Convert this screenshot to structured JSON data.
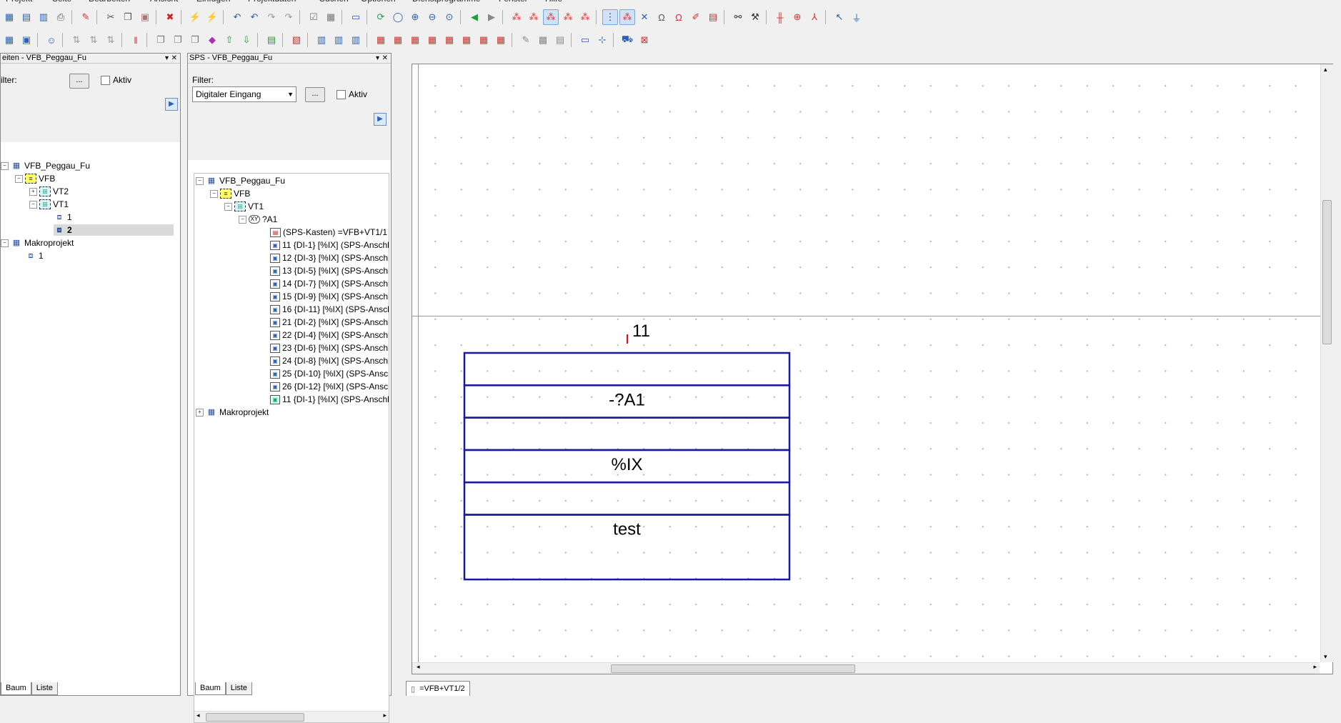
{
  "menu": {
    "items": [
      "Projekt",
      "Seite",
      "Bearbeiten",
      "Ansicht",
      "Einfügen",
      "Projektdaten",
      "Suchen",
      "Optionen",
      "Dienstprogramme",
      "Fenster",
      "Hilfe"
    ]
  },
  "left_panel": {
    "title": "eiten - VFB_Peggau_Fu",
    "filter_label": "ilter:",
    "filter_btn": "...",
    "aktiv_label": "Aktiv",
    "tree": [
      {
        "label": "VFB_Peggau_Fu",
        "icon": "project-icon"
      },
      {
        "label": "VFB",
        "icon": "structure-icon"
      },
      {
        "label": "VT2",
        "icon": "installation-icon"
      },
      {
        "label": "VT1",
        "icon": "installation-icon"
      },
      {
        "label": "1",
        "icon": "page-icon"
      },
      {
        "label": "2",
        "icon": "page-icon"
      },
      {
        "label": "Makroprojekt",
        "icon": "project-icon"
      },
      {
        "label": "1",
        "icon": "page-icon"
      }
    ],
    "tabs": [
      "Baum",
      "Liste"
    ]
  },
  "middle_panel": {
    "title": "SPS - VFB_Peggau_Fu",
    "filter_label": "Filter:",
    "filter_value": "Digitaler Eingang",
    "filter_btn": "...",
    "aktiv_label": "Aktiv",
    "tree_top": [
      {
        "label": "VFB_Peggau_Fu",
        "icon": "project-icon"
      },
      {
        "label": "VFB",
        "icon": "structure-icon"
      },
      {
        "label": "VT1",
        "icon": "installation-icon"
      },
      {
        "label": "?A1",
        "icon": "device-icon"
      },
      {
        "label": "(SPS-Kasten) =VFB+VT1/1",
        "icon": "plc-box-icon"
      }
    ],
    "connections": [
      "11 {DI-1} [%IX] (SPS-Anschl",
      "12 {DI-3} [%IX] (SPS-Anschl",
      "13 {DI-5} [%IX] (SPS-Anschl",
      "14 {DI-7} [%IX] (SPS-Anschl",
      "15 {DI-9} [%IX] (SPS-Anschl",
      "16 {DI-11} [%IX] (SPS-Ansch",
      "21 {DI-2} [%IX] (SPS-Anschl",
      "22 {DI-4} [%IX] (SPS-Anschl",
      "23 {DI-6} [%IX] (SPS-Anschl",
      "24 {DI-8} [%IX] (SPS-Anschl",
      "25 {DI-10} [%IX] (SPS-Ansch",
      "26 {DI-12} [%IX] (SPS-Ansch",
      "11 {DI-1} [%IX] (SPS-Anschl"
    ],
    "tree_bottom": {
      "label": "Makroprojekt",
      "icon": "project-icon"
    },
    "tabs": [
      "Baum",
      "Liste"
    ]
  },
  "canvas": {
    "connection_label": "11",
    "box_rows": [
      "",
      "-?A1",
      "",
      "%IX",
      "",
      "test"
    ],
    "accent_color": "#1a1aa0",
    "marker_color": "#e01010"
  },
  "doc_tab": {
    "label": "=VFB+VT1/2"
  }
}
